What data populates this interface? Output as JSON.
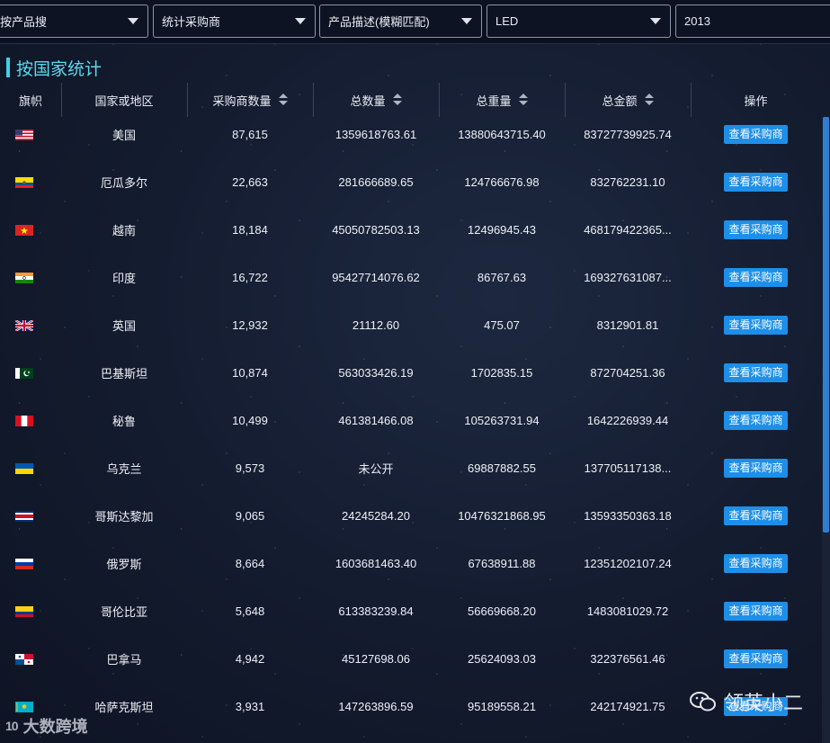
{
  "filters": [
    {
      "value": "按产品搜"
    },
    {
      "value": "统计采购商"
    },
    {
      "value": "产品描述(模糊匹配)"
    },
    {
      "value": "LED"
    },
    {
      "value": "2013"
    }
  ],
  "section_title": "按国家统计",
  "columns": {
    "flag": "旗帜",
    "country": "国家或地区",
    "buyers": "采购商数量",
    "quantity": "总数量",
    "weight": "总重量",
    "amount": "总金额",
    "action": "操作"
  },
  "action_label": "查看采购商",
  "rows": [
    {
      "flag": "us-flag",
      "country": "美国",
      "buyers": "87,615",
      "quantity": "1359618763.61",
      "weight": "13880643715.40",
      "amount": "83727739925.74"
    },
    {
      "flag": "ec-flag",
      "country": "厄瓜多尔",
      "buyers": "22,663",
      "quantity": "281666689.65",
      "weight": "124766676.98",
      "amount": "832762231.10"
    },
    {
      "flag": "vn-flag",
      "country": "越南",
      "buyers": "18,184",
      "quantity": "45050782503.13",
      "weight": "12496945.43",
      "amount": "468179422365..."
    },
    {
      "flag": "in-flag",
      "country": "印度",
      "buyers": "16,722",
      "quantity": "95427714076.62",
      "weight": "86767.63",
      "amount": "169327631087..."
    },
    {
      "flag": "gb-flag",
      "country": "英国",
      "buyers": "12,932",
      "quantity": "21112.60",
      "weight": "475.07",
      "amount": "8312901.81"
    },
    {
      "flag": "pk-flag",
      "country": "巴基斯坦",
      "buyers": "10,874",
      "quantity": "563033426.19",
      "weight": "1702835.15",
      "amount": "872704251.36"
    },
    {
      "flag": "pe-flag",
      "country": "秘鲁",
      "buyers": "10,499",
      "quantity": "461381466.08",
      "weight": "105263731.94",
      "amount": "1642226939.44"
    },
    {
      "flag": "ua-flag",
      "country": "乌克兰",
      "buyers": "9,573",
      "quantity": "未公开",
      "weight": "69887882.55",
      "amount": "137705117138..."
    },
    {
      "flag": "cr-flag",
      "country": "哥斯达黎加",
      "buyers": "9,065",
      "quantity": "24245284.20",
      "weight": "10476321868.95",
      "amount": "13593350363.18"
    },
    {
      "flag": "ru-flag",
      "country": "俄罗斯",
      "buyers": "8,664",
      "quantity": "1603681463.40",
      "weight": "67638911.88",
      "amount": "12351202107.24"
    },
    {
      "flag": "co-flag",
      "country": "哥伦比亚",
      "buyers": "5,648",
      "quantity": "613383239.84",
      "weight": "56669668.20",
      "amount": "1483081029.72"
    },
    {
      "flag": "pa-flag",
      "country": "巴拿马",
      "buyers": "4,942",
      "quantity": "45127698.06",
      "weight": "25624093.03",
      "amount": "322376561.46"
    },
    {
      "flag": "kz-flag",
      "country": "哈萨克斯坦",
      "buyers": "3,931",
      "quantity": "147263896.59",
      "weight": "95189558.21",
      "amount": "242174921.75"
    }
  ],
  "watermark_left": "大数跨境",
  "watermark_left_logo": "10",
  "watermark_right": "领英小二",
  "colors": {
    "accent": "#5cd9ec",
    "button": "#1e8fe8",
    "scroll_thumb": "#2e7fd4"
  }
}
